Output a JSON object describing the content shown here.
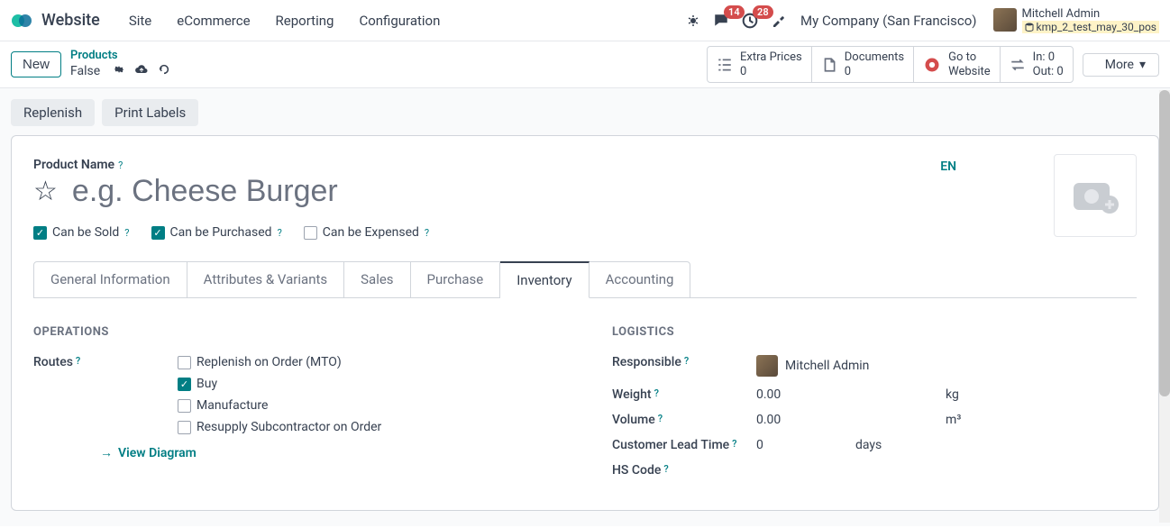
{
  "header": {
    "brand": "Website",
    "nav": [
      "Site",
      "eCommerce",
      "Reporting",
      "Configuration"
    ],
    "messages_badge": "14",
    "activities_badge": "28",
    "company": "My Company (San Francisco)",
    "user_name": "Mitchell Admin",
    "db_name": "kmp_2_test_may_30_pos"
  },
  "controlbar": {
    "new_button": "New",
    "breadcrumb_top": "Products",
    "breadcrumb_current": "False",
    "stats": {
      "extra_prices_label": "Extra Prices",
      "extra_prices_value": "0",
      "documents_label": "Documents",
      "documents_value": "0",
      "goto_label1": "Go to",
      "goto_label2": "Website",
      "in_label": "In: 0",
      "out_label": "Out: 0",
      "more": "More"
    }
  },
  "actions": {
    "replenish": "Replenish",
    "print_labels": "Print Labels"
  },
  "form": {
    "product_name_label": "Product Name",
    "product_name_placeholder": "e.g. Cheese Burger",
    "lang": "EN",
    "can_be_sold": "Can be Sold",
    "can_be_purchased": "Can be Purchased",
    "can_be_expensed": "Can be Expensed",
    "tabs": {
      "general": "General Information",
      "attributes": "Attributes & Variants",
      "sales": "Sales",
      "purchase": "Purchase",
      "inventory": "Inventory",
      "accounting": "Accounting"
    },
    "operations": {
      "title": "OPERATIONS",
      "routes_label": "Routes",
      "route_mto": "Replenish on Order (MTO)",
      "route_buy": "Buy",
      "route_manufacture": "Manufacture",
      "route_resupply": "Resupply Subcontractor on Order",
      "view_diagram": "View Diagram"
    },
    "logistics": {
      "title": "LOGISTICS",
      "responsible_label": "Responsible",
      "responsible_value": "Mitchell Admin",
      "weight_label": "Weight",
      "weight_value": "0.00",
      "weight_unit": "kg",
      "volume_label": "Volume",
      "volume_value": "0.00",
      "volume_unit": "m³",
      "lead_time_label": "Customer Lead Time",
      "lead_time_value": "0",
      "lead_time_unit": "days",
      "hs_code_label": "HS Code"
    }
  }
}
